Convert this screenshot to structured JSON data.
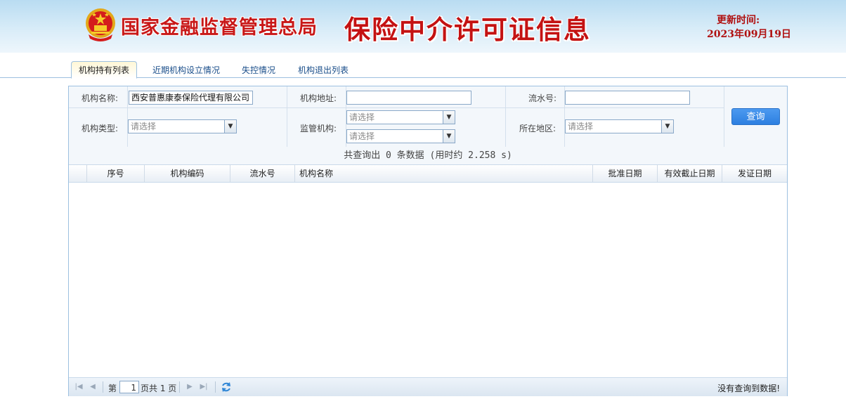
{
  "header": {
    "org_name": "国家金融监督管理总局",
    "system_title": "保险中介许可证信息",
    "update_label": "更新时间:",
    "update_date": "2023年09月19日"
  },
  "tabs": [
    {
      "label": "机构持有列表",
      "active": true
    },
    {
      "label": "近期机构设立情况",
      "active": false
    },
    {
      "label": "失控情况",
      "active": false
    },
    {
      "label": "机构退出列表",
      "active": false
    }
  ],
  "search": {
    "org_name_label": "机构名称:",
    "org_name_value": "西安普惠康泰保险代理有限公司",
    "org_addr_label": "机构地址:",
    "org_addr_value": "",
    "serial_label": "流水号:",
    "serial_value": "",
    "org_type_label": "机构类型:",
    "org_type_value": "请选择",
    "regulator_label": "监管机构:",
    "regulator_value_1": "请选择",
    "regulator_value_2": "请选择",
    "region_label": "所在地区:",
    "region_value": "请选择",
    "query_button": "查询"
  },
  "result_info": "共查询出 0 条数据 (用时约 2.258 s)",
  "table": {
    "columns": [
      "序号",
      "机构编码",
      "流水号",
      "机构名称",
      "批准日期",
      "有效截止日期",
      "发证日期"
    ],
    "rows": []
  },
  "pager": {
    "page_prefix": "第",
    "current_page": "1",
    "page_suffix": "页共 1 页",
    "status": "没有查询到数据!"
  },
  "colors": {
    "accent": "#2d7fe0",
    "title_red": "#c41212",
    "border": "#9dc0e0"
  }
}
